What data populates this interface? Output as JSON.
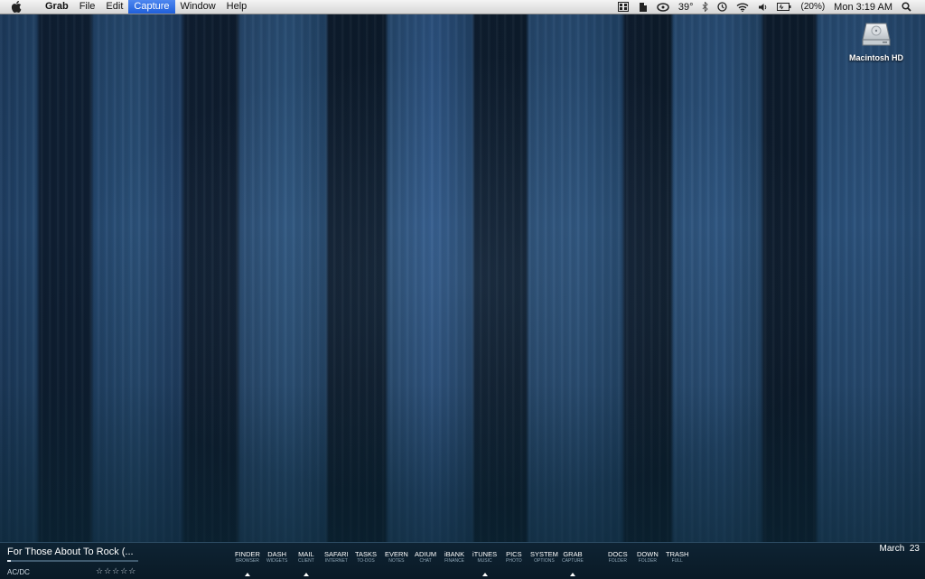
{
  "menubar": {
    "app_name": "Grab",
    "items": [
      "File",
      "Edit",
      "Capture",
      "Window",
      "Help"
    ],
    "active_item": "Capture",
    "status": {
      "temperature": "39°",
      "battery": "(20%)",
      "clock": "Mon 3:19 AM"
    }
  },
  "desktop": {
    "drive_label": "Macintosh HD"
  },
  "now_playing": {
    "title": "For Those About To Rock (...",
    "artist": "AC/DC",
    "stars": "☆☆☆☆☆",
    "progress_fraction": 0.03
  },
  "dock": [
    {
      "label": "FINDER",
      "sub": "BROWSER",
      "running": true
    },
    {
      "label": "DASH",
      "sub": "WIDGETS",
      "running": false
    },
    {
      "label": "MAIL",
      "sub": "CLIENT",
      "running": true
    },
    {
      "label": "SAFARI",
      "sub": "INTERNET",
      "running": false
    },
    {
      "label": "TASKS",
      "sub": "TO-DOS",
      "running": false
    },
    {
      "label": "EVERN",
      "sub": "NOTES",
      "running": false
    },
    {
      "label": "ADIUM",
      "sub": "CHAT",
      "running": false
    },
    {
      "label": "iBANK",
      "sub": "FINANCE",
      "running": false
    },
    {
      "label": "iTUNES",
      "sub": "MUSIC",
      "running": true
    },
    {
      "label": "PICS",
      "sub": "PHOTO",
      "running": false
    },
    {
      "label": "SYSTEM",
      "sub": "OPTIONS",
      "running": false
    },
    {
      "label": "GRAB",
      "sub": "CAPTURE",
      "running": true
    },
    {
      "label": "DOCS",
      "sub": "FOLDER",
      "running": false
    },
    {
      "label": "DOWN",
      "sub": "FOLDER",
      "running": false
    },
    {
      "label": "TRASH",
      "sub": "FULL",
      "running": false
    }
  ],
  "date": "March  23",
  "colors": {
    "menu_highlight": "#2a67e0",
    "bottom_bar": "#0c1e2c"
  }
}
